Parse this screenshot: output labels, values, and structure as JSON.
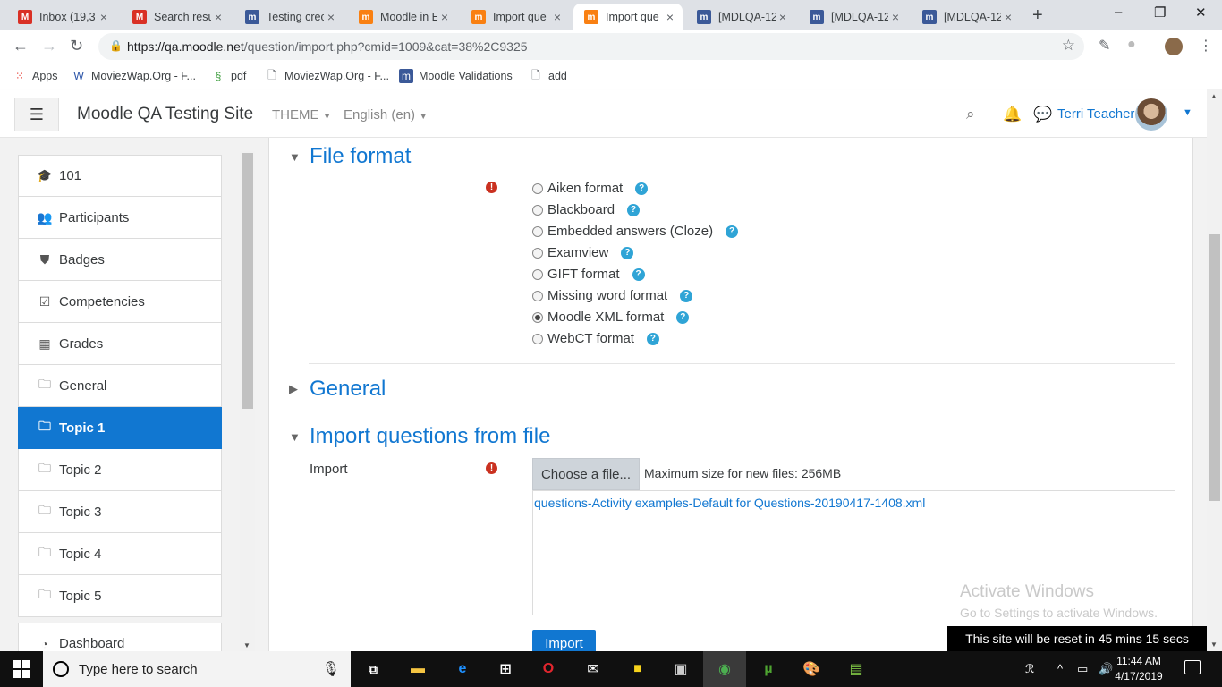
{
  "browser": {
    "tabs": [
      {
        "title": "Inbox (19,3",
        "icon": "gmail-icon",
        "color": "#d93025",
        "glyph": "M"
      },
      {
        "title": "Search resu",
        "icon": "gmail-icon",
        "color": "#d93025",
        "glyph": "M"
      },
      {
        "title": "Testing crec",
        "icon": "moodle-tracker-icon",
        "color": "#3b5998",
        "glyph": "m"
      },
      {
        "title": "Moodle in E",
        "icon": "moodle-icon",
        "color": "#f98012",
        "glyph": "m"
      },
      {
        "title": "Import que",
        "icon": "moodle-icon",
        "color": "#f98012",
        "glyph": "m"
      },
      {
        "title": "Import que",
        "icon": "moodle-icon",
        "color": "#f98012",
        "glyph": "m",
        "active": true
      },
      {
        "title": "[MDLQA-12",
        "icon": "moodle-tracker-icon",
        "color": "#3b5998",
        "glyph": "m"
      },
      {
        "title": "[MDLQA-12",
        "icon": "moodle-tracker-icon",
        "color": "#3b5998",
        "glyph": "m"
      },
      {
        "title": "[MDLQA-12",
        "icon": "moodle-tracker-icon",
        "color": "#3b5998",
        "glyph": "m"
      }
    ],
    "url_host": "https://qa.moodle.net",
    "url_path": "/question/import.php?cmid=1009&cat=38%2C9325",
    "bookmarks": [
      {
        "label": "Apps",
        "icon": "apps-grid-icon"
      },
      {
        "label": "MoviezWap.Org - F...",
        "icon": "moviezwap-icon"
      },
      {
        "label": "pdf",
        "icon": "leaf-icon"
      },
      {
        "label": "MoviezWap.Org - F...",
        "icon": "page-icon"
      },
      {
        "label": "Moodle Validations",
        "icon": "moodle-tracker-icon"
      },
      {
        "label": "add",
        "icon": "page-icon"
      }
    ]
  },
  "navbar": {
    "site_name": "Moodle QA Testing Site",
    "theme_label": "THEME",
    "language_label": "English (en)",
    "user_name": "Terri Teacher"
  },
  "sidebar": {
    "items": [
      {
        "label": "101",
        "icon": "graduation-cap-icon",
        "glyph": "🎓"
      },
      {
        "label": "Participants",
        "icon": "users-icon",
        "glyph": "👥"
      },
      {
        "label": "Badges",
        "icon": "shield-icon",
        "glyph": "⛊"
      },
      {
        "label": "Competencies",
        "icon": "checkbox-icon",
        "glyph": "☑"
      },
      {
        "label": "Grades",
        "icon": "table-icon",
        "glyph": "▦"
      },
      {
        "label": "General",
        "icon": "folder-icon",
        "glyph": "🗀"
      },
      {
        "label": "Topic 1",
        "icon": "folder-icon",
        "glyph": "🗀",
        "active": true
      },
      {
        "label": "Topic 2",
        "icon": "folder-icon",
        "glyph": "🗀"
      },
      {
        "label": "Topic 3",
        "icon": "folder-icon",
        "glyph": "🗀"
      },
      {
        "label": "Topic 4",
        "icon": "folder-icon",
        "glyph": "🗀"
      },
      {
        "label": "Topic 5",
        "icon": "folder-icon",
        "glyph": "🗀"
      },
      {
        "label": "Dashboard",
        "icon": "dashboard-icon",
        "glyph": "◔"
      }
    ]
  },
  "main": {
    "file_format": {
      "heading": "File format",
      "options": [
        {
          "label": "Aiken format",
          "selected": false
        },
        {
          "label": "Blackboard",
          "selected": false
        },
        {
          "label": "Embedded answers (Cloze)",
          "selected": false
        },
        {
          "label": "Examview",
          "selected": false
        },
        {
          "label": "GIFT format",
          "selected": false
        },
        {
          "label": "Missing word format",
          "selected": false
        },
        {
          "label": "Moodle XML format",
          "selected": true
        },
        {
          "label": "WebCT format",
          "selected": false
        }
      ]
    },
    "general_heading": "General",
    "import_section": {
      "heading": "Import questions from file",
      "field_label": "Import",
      "choose_button": "Choose a file...",
      "max_size": "Maximum size for new files: 256MB",
      "file_name": "questions-Activity examples-Default for Questions-20190417-1408.xml",
      "submit_button": "Import"
    },
    "watermark_line1": "Activate Windows",
    "watermark_line2": "Go to Settings to activate Windows.",
    "reset_notice": "This site will be reset in 45 mins 15 secs"
  },
  "taskbar": {
    "search_placeholder": "Type here to search",
    "time": "11:44 AM",
    "date": "4/17/2019"
  },
  "colors": {
    "accent": "#1177d1",
    "required": "#ca3120",
    "help": "#2fa4d6"
  }
}
